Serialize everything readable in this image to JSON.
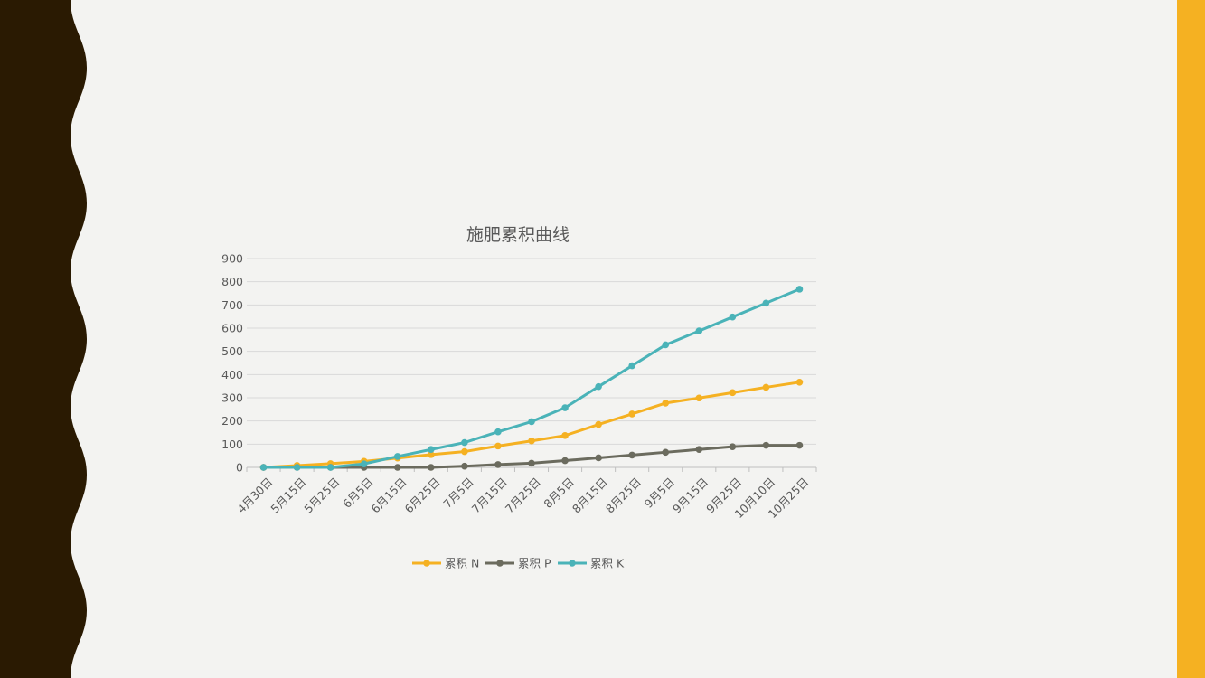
{
  "theme": {
    "background": "#f3f3f1",
    "left_wave_color": "#2a1a02",
    "right_bar_color": "#f5b122",
    "gridline_color": "#d9d9d9",
    "text_color": "#595959"
  },
  "chart_data": {
    "type": "line",
    "title": "施肥累积曲线",
    "categories": [
      "4月30日",
      "5月15日",
      "5月25日",
      "6月5日",
      "6月15日",
      "6月25日",
      "7月5日",
      "7月15日",
      "7月25日",
      "8月5日",
      "8月15日",
      "8月25日",
      "9月5日",
      "9月15日",
      "9月25日",
      "10月10日",
      "10月25日"
    ],
    "series": [
      {
        "name": "累积 N",
        "color": "#f5b122",
        "values": [
          0,
          8,
          16,
          26,
          40,
          55,
          68,
          92,
          114,
          137,
          185,
          230,
          277,
          299,
          322,
          345,
          367
        ]
      },
      {
        "name": "累积 P",
        "color": "#6b6b5e",
        "values": [
          0,
          0,
          0,
          0,
          0,
          0,
          5,
          12,
          18,
          29,
          41,
          53,
          65,
          77,
          89,
          95,
          95
        ]
      },
      {
        "name": "累积 K",
        "color": "#4ab3b8",
        "values": [
          0,
          0,
          0,
          15,
          47,
          77,
          107,
          153,
          197,
          257,
          348,
          438,
          528,
          588,
          648,
          708,
          768
        ]
      }
    ],
    "ylim": [
      0,
      900
    ],
    "yticks": [
      "0",
      "100",
      "200",
      "300",
      "400",
      "500",
      "600",
      "700",
      "800",
      "900"
    ],
    "grid": true,
    "legend": "bottom"
  }
}
